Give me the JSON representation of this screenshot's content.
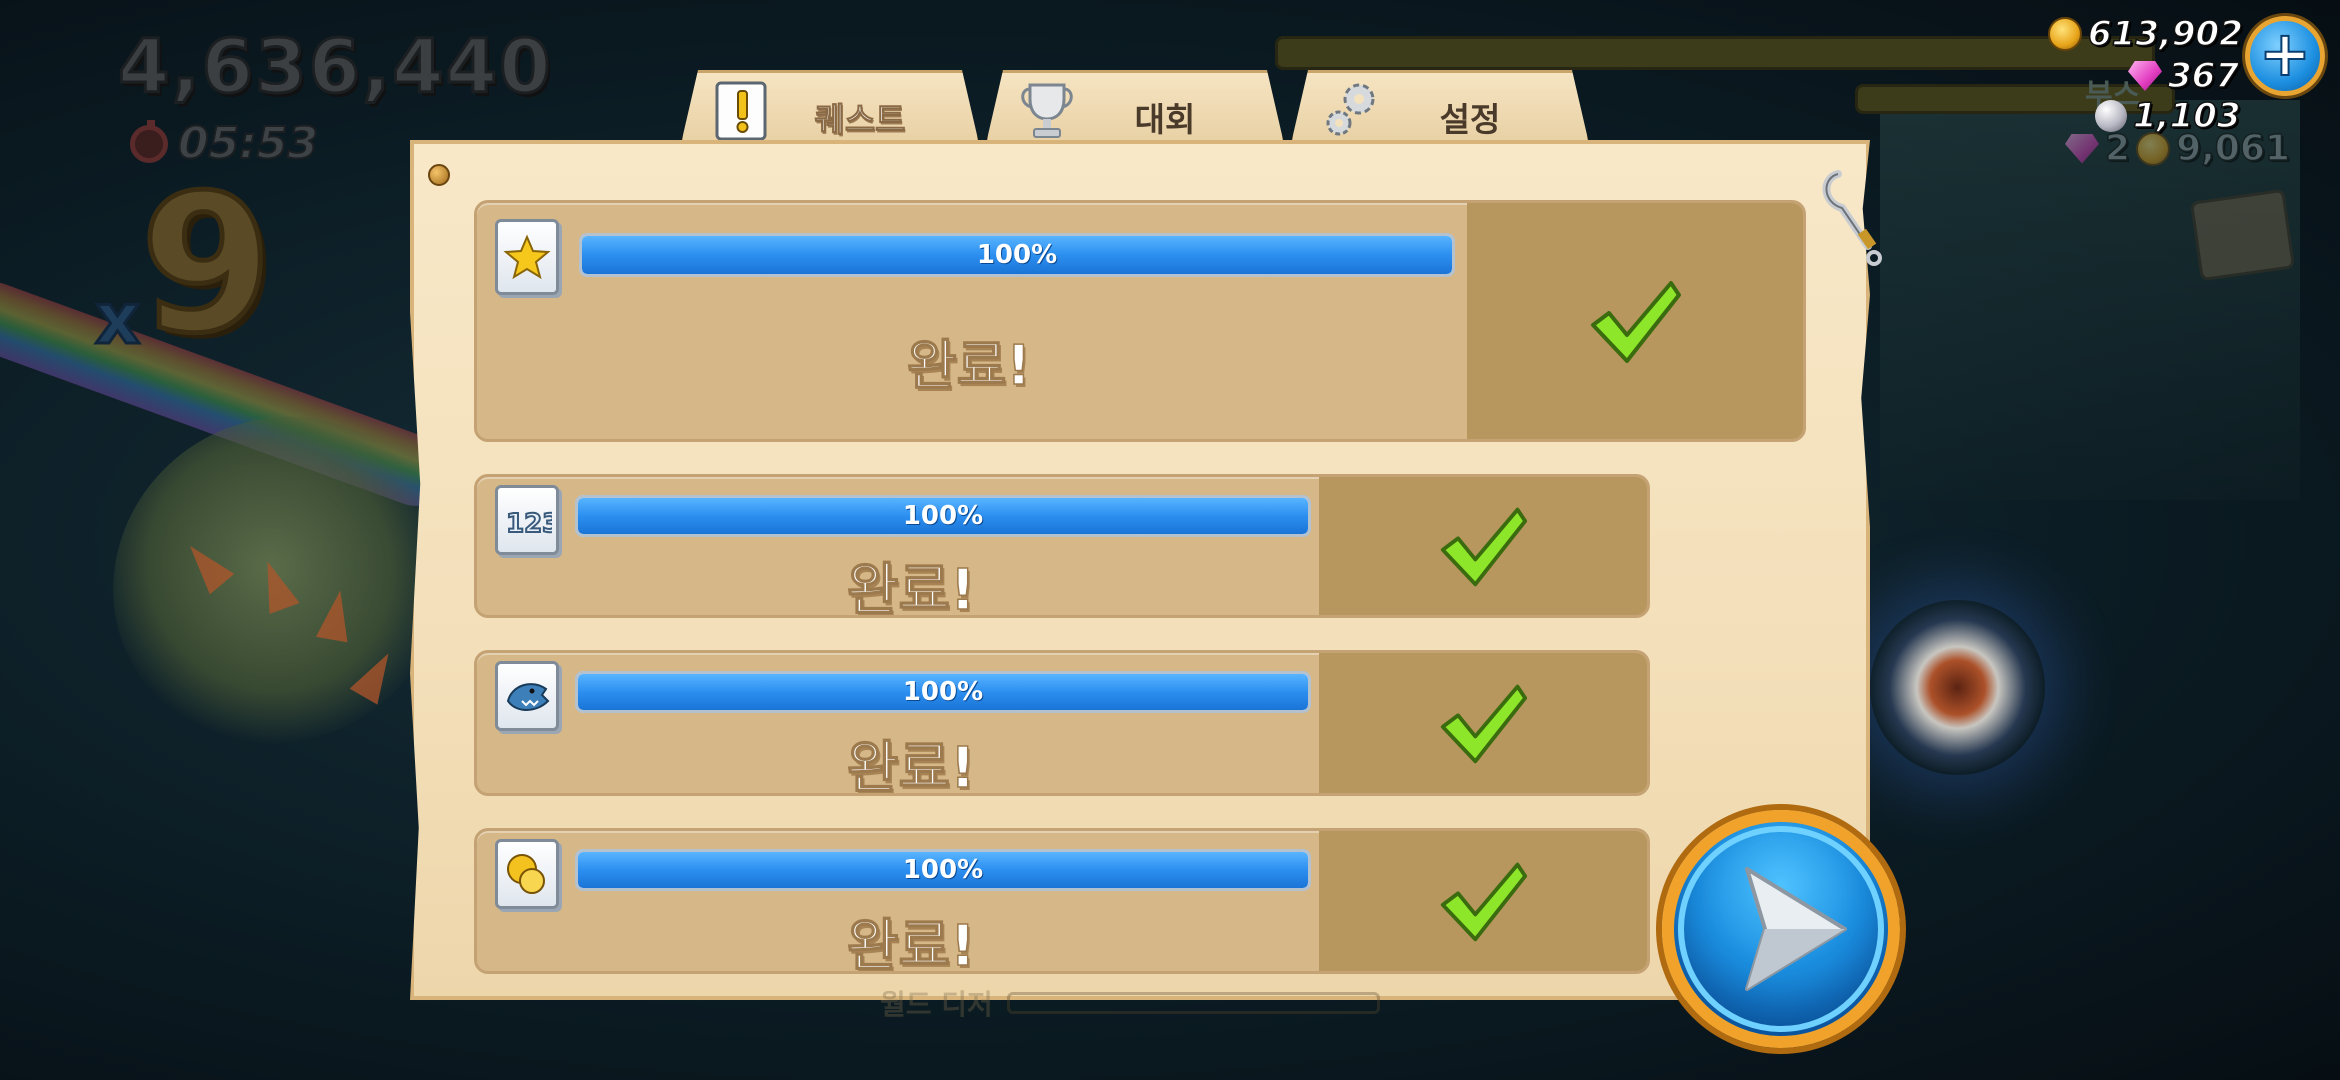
{
  "hud": {
    "score": "4,636,440",
    "timer": "05:53",
    "multiplier_x": "x",
    "multiplier_value": "9",
    "boost_label": "부스",
    "currencies": {
      "coins": "613,902",
      "gems": "367",
      "pearls": "1,103"
    },
    "dim_gems": "2",
    "dim_coins": "9,061"
  },
  "tabs": [
    {
      "label": "퀘스트",
      "icon": "quest-exclamation-icon",
      "active": true
    },
    {
      "label": "대회",
      "icon": "trophy-icon",
      "active": false
    },
    {
      "label": "설정",
      "icon": "gears-icon",
      "active": false
    }
  ],
  "quests": [
    {
      "icon": "star-badge-icon",
      "progress_label": "100%",
      "progress": 1.0,
      "status": "완료!"
    },
    {
      "icon": "numbers-123-icon",
      "progress_label": "100%",
      "progress": 1.0,
      "status": "완료!"
    },
    {
      "icon": "shark-icon",
      "progress_label": "100%",
      "progress": 1.0,
      "status": "완료!"
    },
    {
      "icon": "coins-icon",
      "progress_label": "100%",
      "progress": 1.0,
      "status": "완료!"
    }
  ],
  "bottom_ghost_label": "월드 디저",
  "colors": {
    "progress_blue": "#2c8ff0",
    "check_green": "#8ee62a",
    "panel_parchment": "#f3dfb9",
    "play_button_blue": "#1b8fe0",
    "play_button_ring": "#f0a22b"
  }
}
